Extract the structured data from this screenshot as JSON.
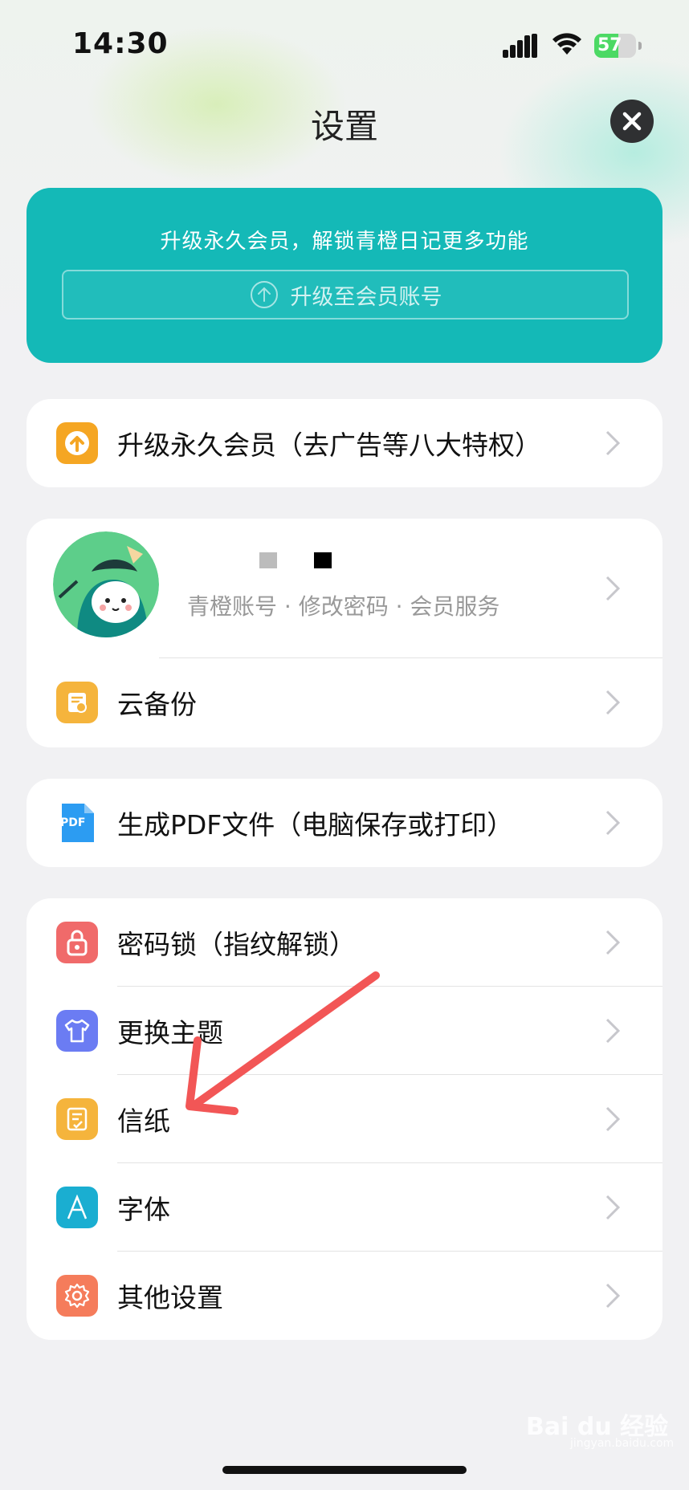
{
  "status_bar": {
    "time": "14:30",
    "battery_percent": "57",
    "battery_level": 0.57
  },
  "header": {
    "title": "设置",
    "close_icon": "close-icon"
  },
  "promo": {
    "text": "升级永久会员，解锁青橙日记更多功能",
    "button_label": "升级至会员账号"
  },
  "vip": {
    "label": "升级永久会员（去广告等八大特权）",
    "color": "#f5a623"
  },
  "account": {
    "sub": "青橙账号 · 修改密码 · 会员服务",
    "cloud_label": "云备份"
  },
  "pdf": {
    "label": "生成PDF文件（电脑保存或打印）",
    "icon_text": "PDF"
  },
  "settings": [
    {
      "label": "密码锁（指纹解锁）",
      "icon": "lock-icon",
      "color": "#f06a6a"
    },
    {
      "label": "更换主题",
      "icon": "tshirt-icon",
      "color": "#6b7cf3"
    },
    {
      "label": "信纸",
      "icon": "stationery-icon",
      "color": "#f5b43c"
    },
    {
      "label": "字体",
      "icon": "font-icon",
      "color": "#1aaed1"
    },
    {
      "label": "其他设置",
      "icon": "gear-icon",
      "color": "#f57c5b"
    }
  ],
  "watermark": {
    "brand": "Bai du 经验",
    "url": "jingyan.baidu.com"
  }
}
